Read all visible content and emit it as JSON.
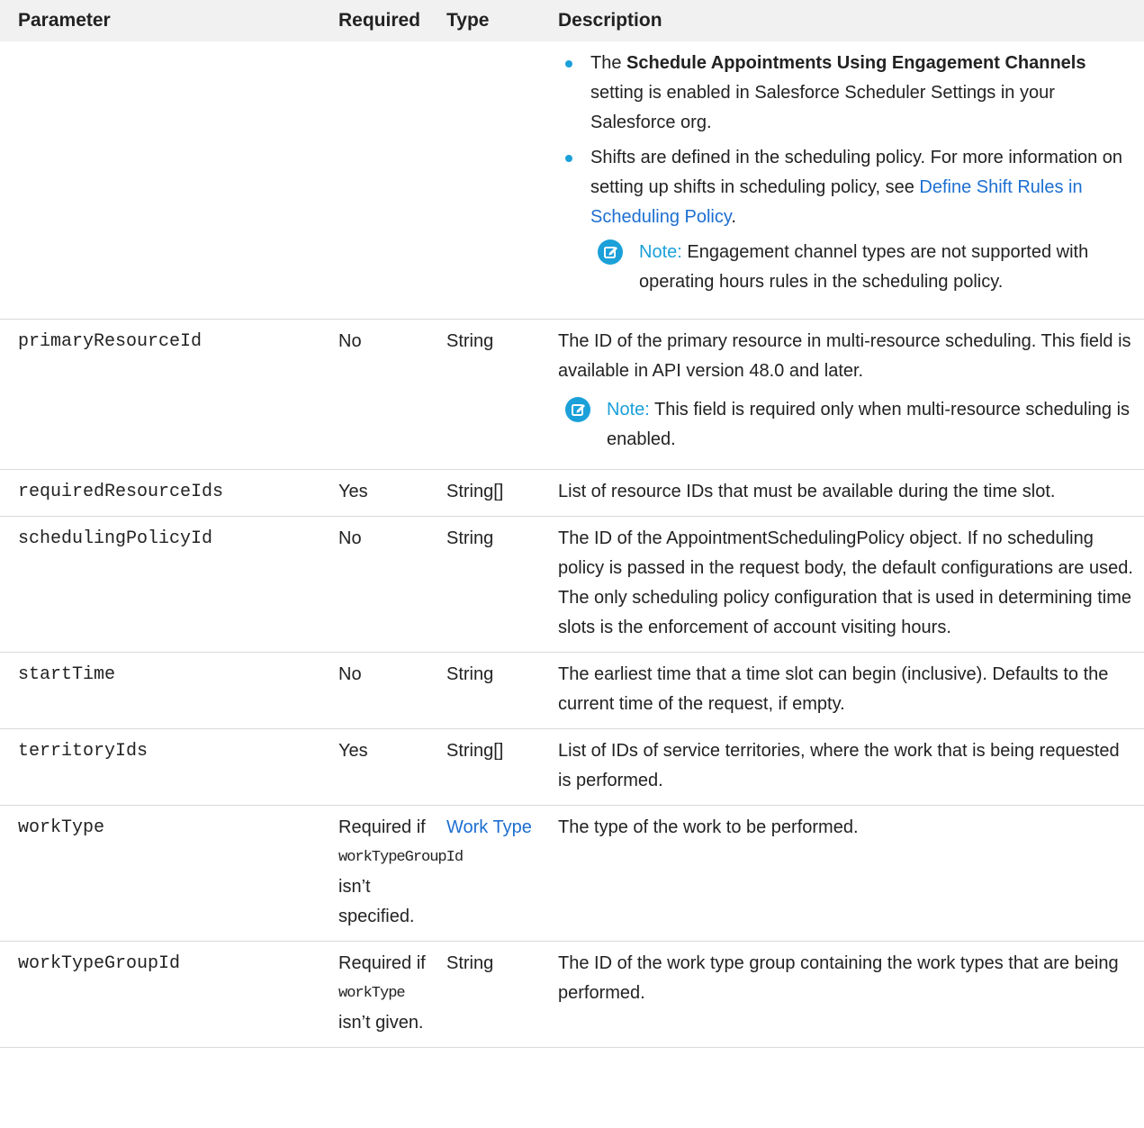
{
  "columns": {
    "parameter": "Parameter",
    "required": "Required",
    "type": "Type",
    "description": "Description"
  },
  "first_row": {
    "bullet1": {
      "pre": "The ",
      "bold": "Schedule Appointments Using Engagement Channels",
      "post": " setting is enabled in Salesforce Scheduler Settings in your Salesforce org."
    },
    "bullet2": {
      "text": "Shifts are defined in the scheduling policy. For more information on setting up shifts in scheduling policy, see ",
      "link": "Define Shift Rules in Scheduling Policy",
      "end": "."
    },
    "note_label": "Note:",
    "note_text": "Engagement channel types are not supported with operating hours rules in the scheduling policy."
  },
  "rows": [
    {
      "param": "primaryResourceId",
      "required": "No",
      "type": "String",
      "description": "The ID of the primary resource in multi-resource scheduling. This field is available in API version 48.0 and later.",
      "note_label": "Note:",
      "note_text": "This field is required only when multi-resource scheduling is enabled."
    },
    {
      "param": "requiredResourceIds",
      "required": "Yes",
      "type": "String[]",
      "description": "List of resource IDs that must be available during the time slot."
    },
    {
      "param": "schedulingPolicyId",
      "required": "No",
      "type": "String",
      "description": "The ID of the AppointmentSchedulingPolicy object. If no scheduling policy is passed in the request body, the default configurations are used. The only scheduling policy configuration that is used in determining time slots is the enforcement of account visiting hours."
    },
    {
      "param": "startTime",
      "required": "No",
      "type": "String",
      "description": "The earliest time that a time slot can begin (inclusive). Defaults to the current time of the request, if empty."
    },
    {
      "param": "territoryIds",
      "required": "Yes",
      "type": "String[]",
      "description": "List of IDs of service territories, where the work that is being requested is performed."
    },
    {
      "param": "workType",
      "required_pre": "Required if",
      "required_code": "workTypeGroupId",
      "required_post": "isn’t specified.",
      "type": "Work Type",
      "description": "The type of the work to be performed."
    },
    {
      "param": "workTypeGroupId",
      "required_pre": "Required if",
      "required_code": "workType",
      "required_post": "isn’t given.",
      "type": "String",
      "description": "The ID of the work type group containing the work types that are being performed."
    }
  ],
  "colors": {
    "link": "#1c6fd1",
    "accent": "#1ba0d9",
    "header_bg": "#f1f1f1"
  }
}
